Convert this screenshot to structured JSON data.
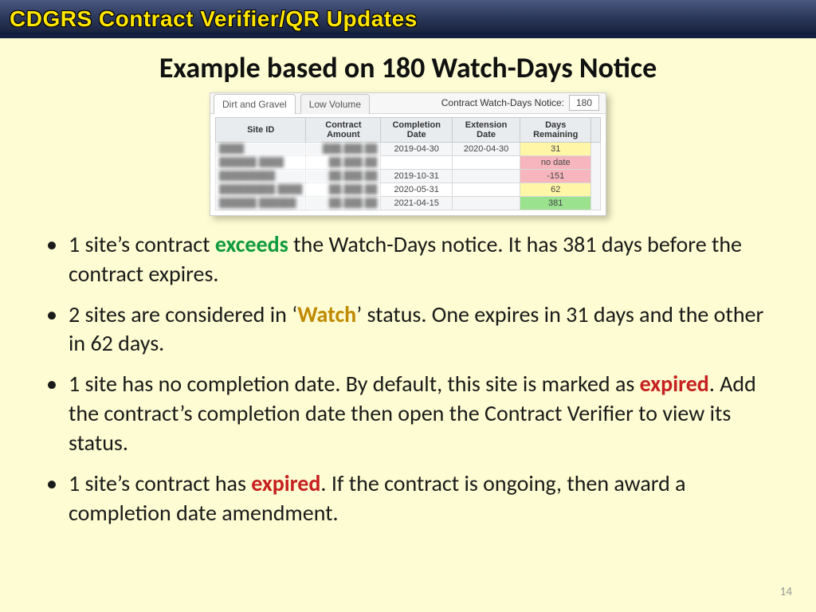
{
  "header": {
    "title": "CDGRS Contract Verifier/QR Updates"
  },
  "slide": {
    "title": "Example based on 180 Watch-Days Notice",
    "page_number": "14"
  },
  "embed": {
    "tabs": {
      "active": "Dirt and Gravel",
      "inactive": "Low Volume"
    },
    "watch_label": "Contract Watch-Days Notice:",
    "watch_value": "180",
    "columns": [
      "Site ID",
      "Contract Amount",
      "Completion Date",
      "Extension Date",
      "Days Remaining"
    ],
    "rows": [
      {
        "completion": "2019-04-30",
        "extension": "2020-04-30",
        "days": "31",
        "status": "yellow"
      },
      {
        "completion": "",
        "extension": "",
        "days": "no date",
        "status": "pink"
      },
      {
        "completion": "2019-10-31",
        "extension": "",
        "days": "-151",
        "status": "pink"
      },
      {
        "completion": "2020-05-31",
        "extension": "",
        "days": "62",
        "status": "yellow"
      },
      {
        "completion": "2021-04-15",
        "extension": "",
        "days": "381",
        "status": "green"
      }
    ]
  },
  "bullets": {
    "b1a": "1 site’s contract ",
    "b1k": "exceeds",
    "b1b": " the Watch-Days notice. It has 381 days before the contract expires.",
    "b2a": "2 sites are considered in ‘",
    "b2k": "Watch",
    "b2b": "’ status. One expires in 31 days and the other in 62 days.",
    "b3a": "1 site has no completion date. By default, this site is marked as ",
    "b3k": "expired",
    "b3b": ". Add the contract’s completion date then open the Contract Verifier to view its status.",
    "b4a": "1 site’s contract has ",
    "b4k": "expired",
    "b4b": ". If the contract is ongoing, then award a completion date amendment."
  }
}
